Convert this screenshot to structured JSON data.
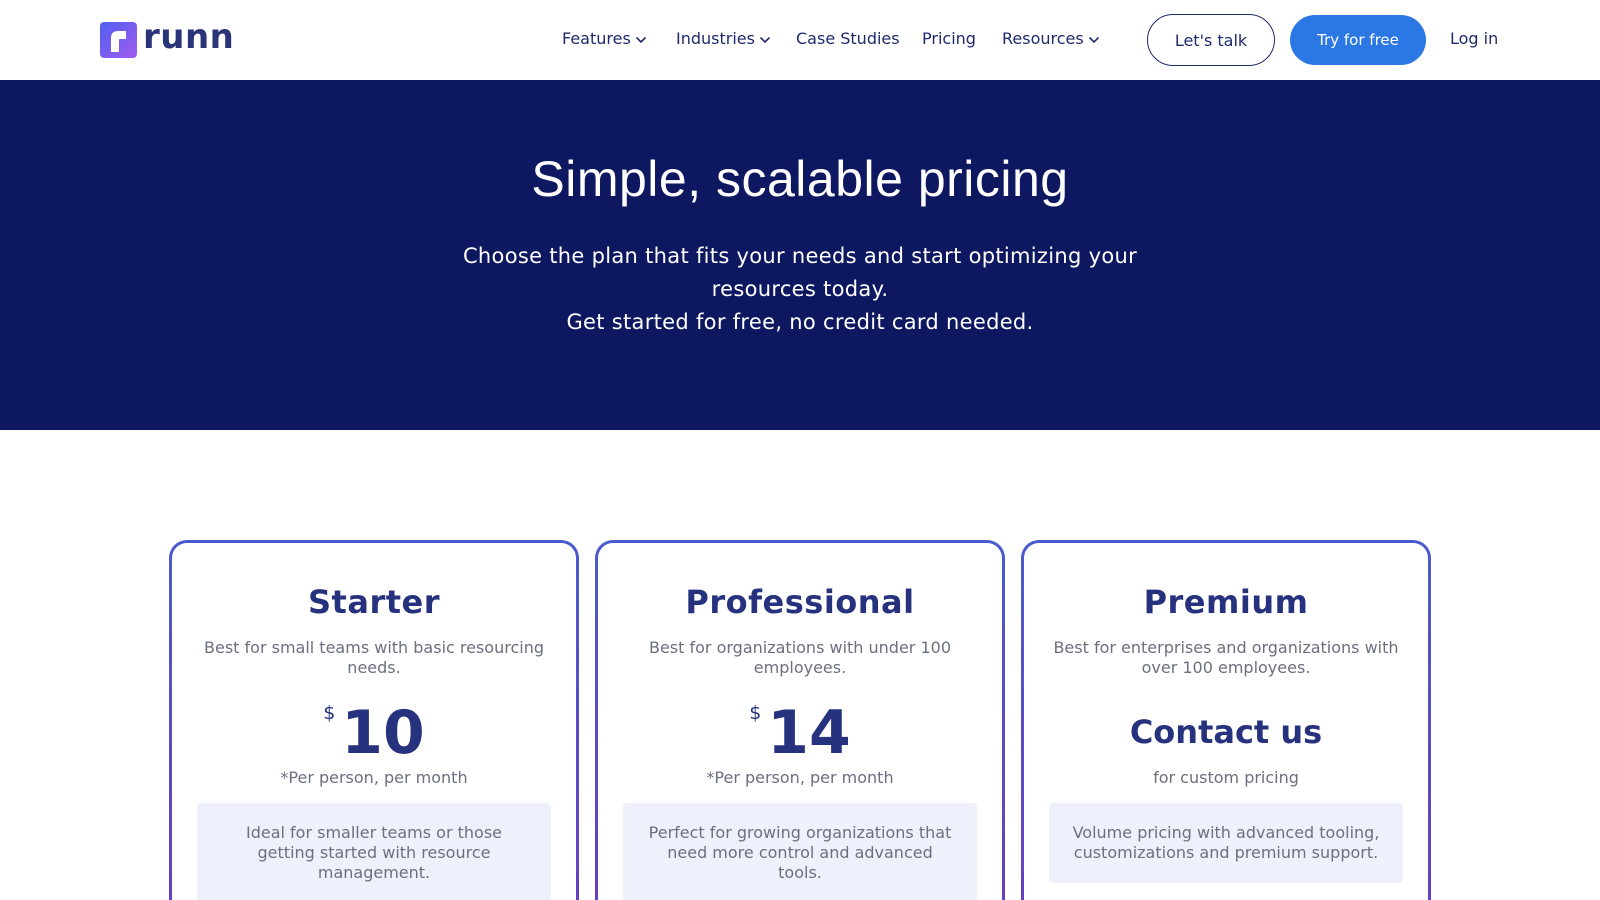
{
  "nav": {
    "logo_text": "runn",
    "items": [
      {
        "label": "Features",
        "has_dropdown": true
      },
      {
        "label": "Industries",
        "has_dropdown": true
      },
      {
        "label": "Case Studies",
        "has_dropdown": false
      },
      {
        "label": "Pricing",
        "has_dropdown": false
      },
      {
        "label": "Resources",
        "has_dropdown": true
      }
    ],
    "talk_label": "Let's talk",
    "try_label": "Try for free",
    "login_label": "Log in"
  },
  "hero": {
    "title": "Simple, scalable pricing",
    "subtitle_line1": "Choose the plan that fits your needs and start optimizing your resources today.",
    "subtitle_line2": "Get started for free, no credit card needed."
  },
  "plans": [
    {
      "name": "Starter",
      "description": "Best for small teams with basic resourcing needs.",
      "currency": "$",
      "price": "10",
      "price_note": "*Per person, per month",
      "summary": "Ideal for smaller teams or those getting started with resource management."
    },
    {
      "name": "Professional",
      "description": "Best for organizations with under 100 employees.",
      "currency": "$",
      "price": "14",
      "price_note": "*Per person, per month",
      "summary": "Perfect for growing organizations that need more control and advanced tools."
    },
    {
      "name": "Premium",
      "description": "Best for enterprises and organizations with over 100 employees.",
      "contact_label": "Contact us",
      "price_note": "for custom pricing",
      "summary": "Volume pricing with advanced tooling, customizations and premium support."
    }
  ],
  "colors": {
    "hero_bg": "#0e1860",
    "primary_button": "#2b78e4",
    "heading_text": "#27327e",
    "card_border": "#4a5bd0",
    "note_bg": "#eef1fc"
  },
  "icons": {
    "dropdown": "chevron-down-icon",
    "logo": "runn-logo-icon"
  }
}
